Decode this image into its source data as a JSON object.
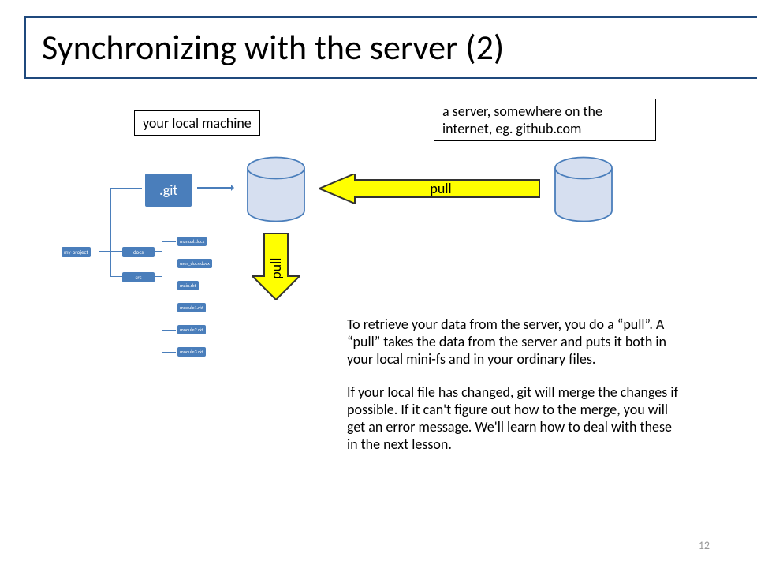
{
  "title": "Synchronizing with the server (2)",
  "labels": {
    "local": "your local machine",
    "server": "a server, somewhere on the internet, eg. github.com"
  },
  "arrows": {
    "pull_h": "pull",
    "pull_v": "pull"
  },
  "tree": {
    "root": "my-project",
    "git": ".git",
    "docs": "docs",
    "src": "src",
    "manual": "manual.docx",
    "userdocs": "user_docs.docx",
    "main": "main.rkt",
    "m1": "module1.rkt",
    "m2": "module2.rkt",
    "m3": "module3.rkt"
  },
  "body": {
    "p1": "To retrieve your data from the server, you do a “pull”. A “pull” takes the data from the server and puts it both in your local mini-fs and in your ordinary files.",
    "p2": "If your local file has changed, git will merge the changes if possible. If it can't figure out how to the merge, you will get an error message. We'll learn how to deal with these in the next lesson."
  },
  "page": "12"
}
